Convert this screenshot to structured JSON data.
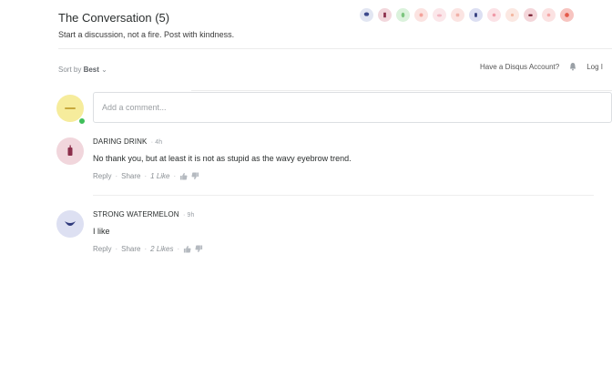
{
  "header": {
    "title": "The Conversation (5)",
    "subtitle": "Start a discussion, not a fire. Post with kindness."
  },
  "reaction_avatars": [
    {
      "icon": "jellyfish-icon",
      "color": "#e2e6f2"
    },
    {
      "icon": "drink-icon",
      "color": "#f2d7dc"
    },
    {
      "icon": "leaf-icon",
      "color": "#dbf2dc"
    },
    {
      "icon": "smile-icon",
      "color": "#fbe3e1"
    },
    {
      "icon": "cloud-icon",
      "color": "#fbe7ea"
    },
    {
      "icon": "cup-icon",
      "color": "#fbe4e2"
    },
    {
      "icon": "cup-icon",
      "color": "#dcdff2"
    },
    {
      "icon": "heart-icon",
      "color": "#fbe2e6"
    },
    {
      "icon": "star-icon",
      "color": "#fbe8e2"
    },
    {
      "icon": "mask-icon",
      "color": "#f4d6da"
    },
    {
      "icon": "flower-icon",
      "color": "#fbe2e2"
    },
    {
      "icon": "fire-icon",
      "color": "#f7c4c0"
    }
  ],
  "sort": {
    "prefix": "Sort by",
    "value": "Best"
  },
  "account": {
    "label": "Have a Disqus Account?",
    "login": "Log I"
  },
  "compose": {
    "placeholder": "Add a comment..."
  },
  "comments": [
    {
      "author": "DARING DRINK",
      "time": "4h",
      "text": "No thank you, but at least it is not as stupid as the wavy eyebrow trend.",
      "reply": "Reply",
      "share": "Share",
      "likes": "1 Like",
      "avatar_color": "#f1d6dc"
    },
    {
      "author": "STRONG WATERMELON",
      "time": "9h",
      "text": "I like",
      "reply": "Reply",
      "share": "Share",
      "likes": "2 Likes",
      "avatar_color": "#dde0f2"
    }
  ]
}
